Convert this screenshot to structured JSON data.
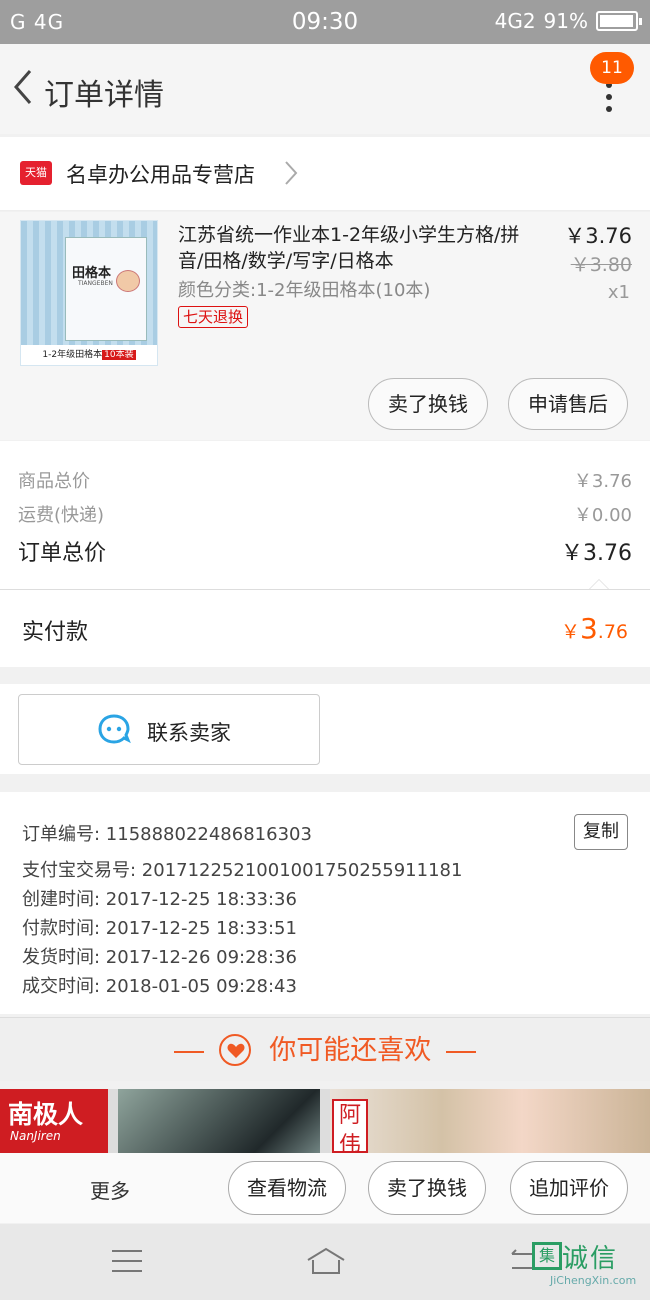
{
  "status_bar": {
    "left": "G 4G",
    "time": "09:30",
    "network": "4G2",
    "battery": "91%"
  },
  "header": {
    "title": "订单详情",
    "badge_count": "11",
    "icons": [
      "chevron-left-icon",
      "more-vertical-icon"
    ]
  },
  "shop": {
    "badge": "天猫",
    "name": "名卓办公用品专营店"
  },
  "product": {
    "thumb": {
      "title": "田格本",
      "subtitle": "TIANGEBEN",
      "bottom": "1-2年级田格本",
      "bottom_tag": "10本装"
    },
    "title": "江苏省统一作业本1-2年级小学生方格/拼音/田格/数学/写字/日格本",
    "attr": "颜色分类:1-2年级田格本(10本)",
    "tag": "七天退换",
    "price": "￥3.76",
    "old_price": "￥3.80",
    "qty": "x1",
    "buttons": {
      "sell": "卖了换钱",
      "aftersale": "申请售后"
    }
  },
  "totals": {
    "goods_label": "商品总价",
    "goods_value": "￥3.76",
    "shipping_label": "运费(快递)",
    "shipping_value": "￥0.00",
    "order_label": "订单总价",
    "order_value": "￥3.76"
  },
  "paid": {
    "label": "实付款",
    "currency": "￥",
    "int": "3",
    "dec": ".76"
  },
  "contact": {
    "label": "联系卖家"
  },
  "order_info": {
    "lines": [
      "订单编号: 115888022486816303",
      "支付宝交易号: 2017122521001001750255911181",
      "创建时间: 2017-12-25 18:33:36",
      "付款时间: 2017-12-25 18:33:51",
      "发货时间: 2017-12-26 09:28:36",
      "成交时间: 2018-01-05 09:28:43"
    ],
    "copy": "复制"
  },
  "recommend": {
    "title": "你可能还喜欢"
  },
  "ads": {
    "brand": "南极人",
    "brand_en": "NanJiren",
    "tag": "阿伟"
  },
  "bottom_bar": {
    "more": "更多",
    "logistics": "查看物流",
    "sell": "卖了换钱",
    "review": "追加评价"
  },
  "watermark": {
    "text": "诚信",
    "box": "集",
    "url": "JiChengXin.com"
  },
  "colors": {
    "accent": "#ff5a00",
    "tmall": "#e5212f",
    "contact_icon": "#2aa4e4"
  }
}
